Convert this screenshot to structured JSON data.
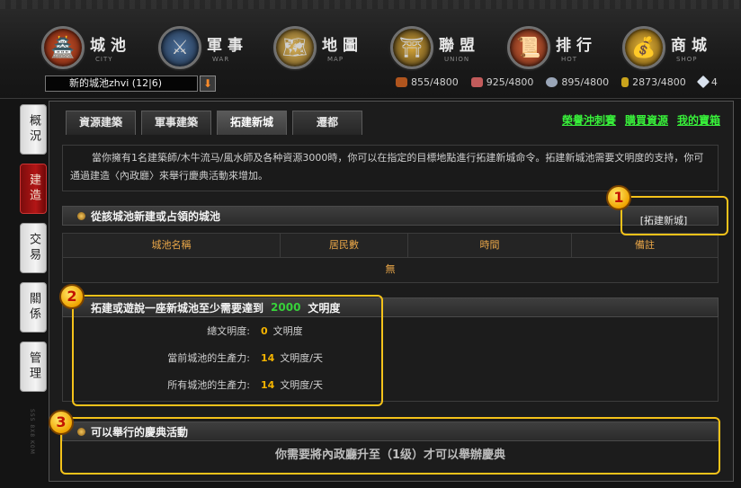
{
  "nav": [
    {
      "label": "城池",
      "sub": "CITY",
      "icon": "city-icon"
    },
    {
      "label": "軍事",
      "sub": "WAR",
      "icon": "war-icon"
    },
    {
      "label": "地圖",
      "sub": "MAP",
      "icon": "map-icon"
    },
    {
      "label": "聯盟",
      "sub": "UNION",
      "icon": "union-icon"
    },
    {
      "label": "排行",
      "sub": "HOT",
      "icon": "rank-icon"
    },
    {
      "label": "商城",
      "sub": "SHOP",
      "icon": "shop-icon"
    }
  ],
  "city_select": {
    "value": "新的城池zhvi  (12|6)"
  },
  "resources": [
    {
      "icon": "wood-icon",
      "value": "855/4800",
      "color": "#b0551e"
    },
    {
      "icon": "meat-icon",
      "value": "925/4800",
      "color": "#c25b5b"
    },
    {
      "icon": "stone-icon",
      "value": "895/4800",
      "color": "#9aa6b8"
    },
    {
      "icon": "grain-icon",
      "value": "2873/4800",
      "color": "#c9a31c"
    },
    {
      "icon": "gem-icon",
      "value": "4",
      "color": "#d9e2ee"
    }
  ],
  "side_tabs": [
    {
      "label": "概況",
      "active": false
    },
    {
      "label": "建造",
      "active": true
    },
    {
      "label": "交易",
      "active": false
    },
    {
      "label": "關係",
      "active": false
    },
    {
      "label": "管理",
      "active": false
    }
  ],
  "tabs": [
    {
      "label": "資源建築",
      "active": false
    },
    {
      "label": "軍事建築",
      "active": false
    },
    {
      "label": "拓建新城",
      "active": true
    },
    {
      "label": "遷都",
      "active": false
    }
  ],
  "top_links": [
    "榮譽沖刺賽",
    "購買資源",
    "我的寶箱"
  ],
  "intro": "當你擁有1名建築師/木牛流马/風水師及各种資源3000時，你可以在指定的目標地點進行拓建新城命令。拓建新城池需要文明度的支持，你可通過建造〈內政廳〉來舉行慶典活動來增加。",
  "section1": {
    "title": "從該城池新建或占領的城池",
    "button": "[拓建新城]"
  },
  "table": {
    "headers": [
      "城池名稱",
      "居民數",
      "時間",
      "備註"
    ],
    "empty": "無"
  },
  "section2": {
    "title_prefix": "拓建或遊說一座新城池至少需要達到",
    "required": "2000",
    "title_suffix": "文明度",
    "rows": [
      {
        "label": "總文明度:",
        "value": "0",
        "unit": "文明度"
      },
      {
        "label": "當前城池的生產力:",
        "value": "14",
        "unit": "文明度/天"
      },
      {
        "label": "所有城池的生產力:",
        "value": "14",
        "unit": "文明度/天"
      }
    ]
  },
  "section3": {
    "title": "可以舉行的慶典活動",
    "message": "你需要將內政廳升至（1级）才可以舉辦慶典"
  },
  "badges": [
    "1",
    "2",
    "3"
  ],
  "vertical_logo": "SSS 8X8 K0M"
}
